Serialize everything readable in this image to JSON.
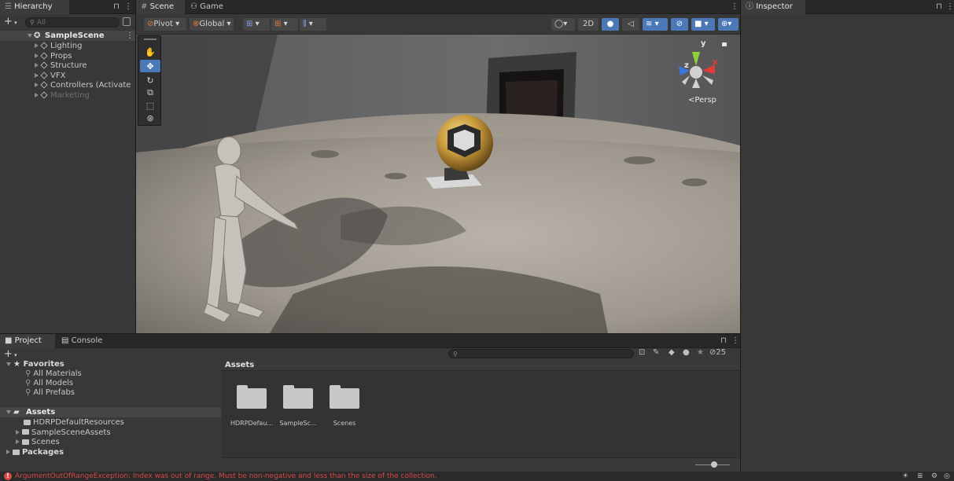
{
  "hierarchy": {
    "tab_label": "Hierarchy",
    "search_placeholder": "All",
    "scene_name": "SampleScene",
    "items": [
      {
        "label": "Lighting",
        "dim": false
      },
      {
        "label": "Props",
        "dim": false
      },
      {
        "label": "Structure",
        "dim": false
      },
      {
        "label": "VFX",
        "dim": false
      },
      {
        "label": "Controllers (Activate on",
        "dim": false
      },
      {
        "label": "Marketing",
        "dim": true
      }
    ]
  },
  "scene_view": {
    "tabs": [
      {
        "label": "Scene",
        "active": true
      },
      {
        "label": "Game",
        "active": false
      }
    ],
    "pivot_label": "Pivot",
    "global_label": "Global",
    "mode_2d_label": "2D",
    "persp_label": "Persp",
    "gizmo_axes": {
      "x": "x",
      "y": "y",
      "z": "z"
    }
  },
  "inspector": {
    "tab_label": "Inspector"
  },
  "project": {
    "tabs": [
      {
        "label": "Project",
        "active": true
      },
      {
        "label": "Console",
        "active": false
      }
    ],
    "search_placeholder": "",
    "hidden_count": "25",
    "favorites_label": "Favorites",
    "favorites": [
      "All Materials",
      "All Models",
      "All Prefabs"
    ],
    "assets_label": "Assets",
    "asset_tree": [
      "HDRPDefaultResources",
      "SampleSceneAssets",
      "Scenes"
    ],
    "packages_label": "Packages",
    "breadcrumb": "Assets",
    "asset_grid": [
      "HDRPDefau...",
      "SampleSc...",
      "Scenes"
    ],
    "zoom_value": 0.55
  },
  "status_bar": {
    "message": "ArgumentOutOfRangeException: Index was out of range. Must be non-negative and less than the size of the collection.",
    "error_color": "#d54a46"
  },
  "colors": {
    "accent_blue": "#4b78b6",
    "panel": "#383838",
    "tabbar": "#282828",
    "axis_x": "#e33b3b",
    "axis_y": "#8fcf3a",
    "axis_z": "#3b74e3"
  }
}
